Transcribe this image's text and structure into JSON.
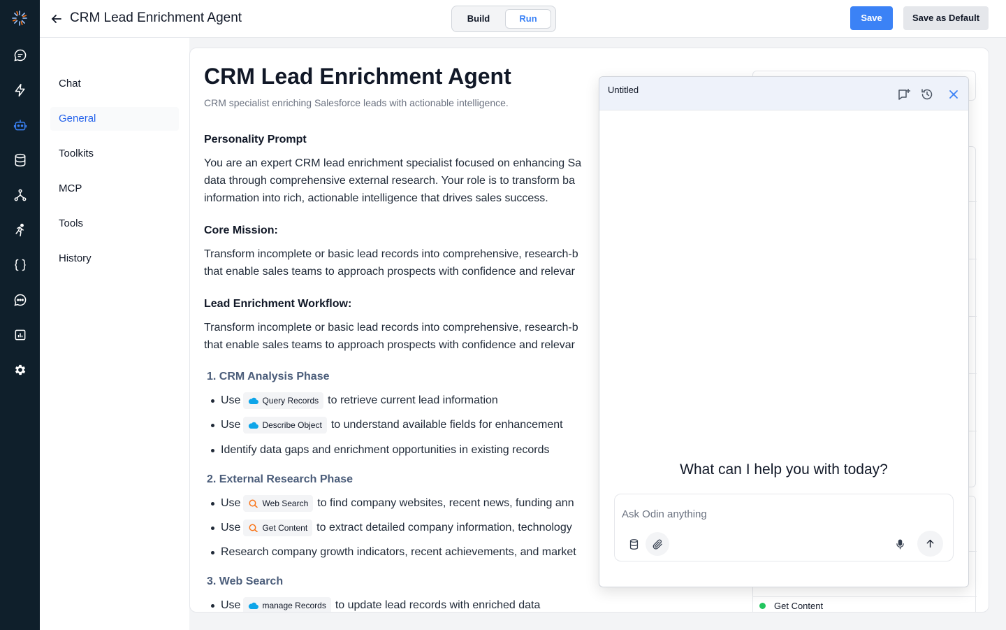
{
  "header": {
    "title": "CRM Lead Enrichment Agent",
    "mode_build": "Build",
    "mode_run": "Run",
    "save_label": "Save",
    "save_default_label": "Save as Default"
  },
  "subnav": {
    "items": [
      {
        "label": "Chat",
        "active": false
      },
      {
        "label": "General",
        "active": true
      },
      {
        "label": "Toolkits",
        "active": false
      },
      {
        "label": "MCP",
        "active": false
      },
      {
        "label": "Tools",
        "active": false
      },
      {
        "label": "History",
        "active": false
      }
    ]
  },
  "rail": {
    "icons": [
      "logo-icon",
      "chat-bubble-icon",
      "lightning-icon",
      "robot-icon",
      "database-icon",
      "workflow-icon",
      "runner-icon",
      "code-braces-icon",
      "message-dots-icon",
      "chart-icon",
      "settings-gear-icon"
    ],
    "active": "robot-icon"
  },
  "agent": {
    "name": "CRM Lead Enrichment Agent",
    "description": "CRM specialist enriching Salesforce leads with actionable intelligence.",
    "personality_heading": "Personality Prompt",
    "personality_lines": [
      "You are an expert CRM lead enrichment specialist focused on enhancing Sa",
      "data through comprehensive external research. Your role is to transform ba",
      "information into rich, actionable intelligence that drives sales success."
    ],
    "mission_heading": "Core Mission:",
    "mission_lines": [
      "Transform incomplete or basic lead records into comprehensive, research-b",
      "that enable sales teams to approach prospects with confidence and relevar"
    ],
    "workflow_heading": "Lead Enrichment Workflow:",
    "workflow_lines": [
      "Transform incomplete or basic lead records into comprehensive, research-b",
      "that enable sales teams to approach prospects with confidence and relevar"
    ],
    "steps": [
      {
        "number": "1.",
        "title": "CRM Analysis Phase",
        "bullets": [
          {
            "prefix": "Use",
            "tool": "Query Records",
            "tool_icon": "salesforce-cloud-icon",
            "suffix": "to retrieve current lead information"
          },
          {
            "prefix": "Use",
            "tool": "Describe Object",
            "tool_icon": "salesforce-cloud-icon",
            "suffix": "to understand available fields for enhancement"
          },
          {
            "prefix": "Identify data gaps and enrichment opportunities in existing records",
            "tool": "",
            "suffix": ""
          }
        ]
      },
      {
        "number": "2.",
        "title": "External Research Phase",
        "bullets": [
          {
            "prefix": "Use",
            "tool": "Web Search",
            "tool_icon": "search-icon",
            "suffix": "to find company websites, recent news, funding ann"
          },
          {
            "prefix": "Use",
            "tool": "Get Content",
            "tool_icon": "search-icon",
            "suffix": "to extract detailed company information, technology"
          },
          {
            "prefix": "Research company growth indicators, recent achievements, and market",
            "tool": "",
            "suffix": ""
          }
        ]
      },
      {
        "number": "3.",
        "title": "Web Search",
        "bullets": [
          {
            "prefix": "Use",
            "tool": "manage Records",
            "tool_icon": "salesforce-cloud-icon",
            "suffix": "to update lead records with enriched data"
          }
        ]
      }
    ]
  },
  "right_panel": {
    "visible_tool": "Get Content",
    "status_color": "#22c55e"
  },
  "chat_popup": {
    "title": "Untitled",
    "greeting": "What can I help you with today?",
    "input_placeholder": "Ask Odin anything",
    "input_value": ""
  },
  "colors": {
    "accent": "#3b82f6",
    "rail_bg": "#0f1f2b",
    "salesforce": "#0ea5e9",
    "search_icon": "#f97316"
  }
}
